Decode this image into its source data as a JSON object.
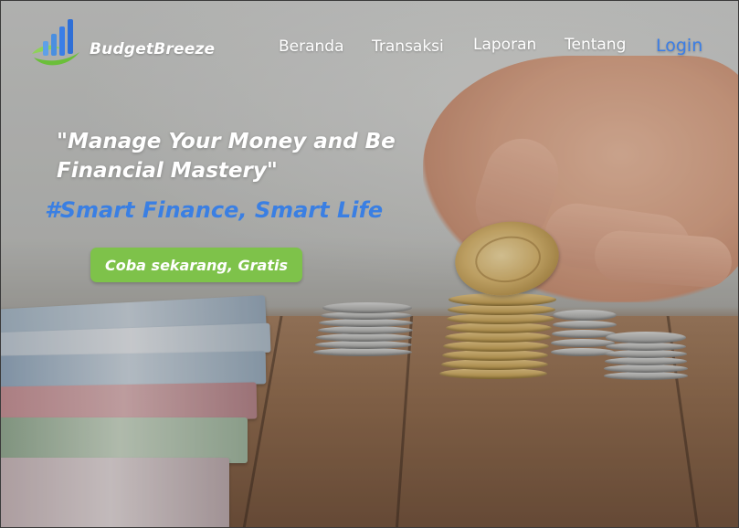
{
  "brand": {
    "name": "BudgetBreeze",
    "logo_icon": "bar-chart-leaf-logo"
  },
  "nav": {
    "items": [
      {
        "label": "Beranda"
      },
      {
        "label": "Transaksi"
      },
      {
        "label": "Laporan"
      },
      {
        "label": "Tentang"
      }
    ],
    "login_label": "Login"
  },
  "hero": {
    "quote": "\"Manage Your Money and Be Financial Mastery\"",
    "tagline": "#Smart Finance, Smart Life",
    "cta_label": "Coba sekarang, Gratis"
  },
  "colors": {
    "accent_blue": "#3b7ee6",
    "cta_green": "#7ec24a",
    "text_white": "#ffffff"
  }
}
